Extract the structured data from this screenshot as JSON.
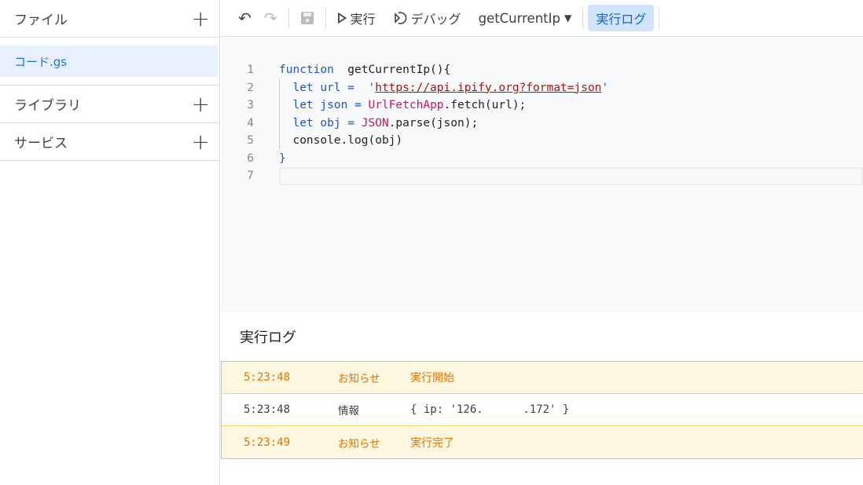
{
  "sidebar": {
    "files_label": "ファイル",
    "file_item": "コード.gs",
    "libraries_label": "ライブラリ",
    "services_label": "サービス"
  },
  "toolbar": {
    "undo_icon": "↶",
    "redo_icon": "↷",
    "run_label": "実行",
    "debug_label": "デバッグ",
    "function_select": "getCurrentIp",
    "log_label": "実行ログ"
  },
  "editor": {
    "lines": [
      {
        "n": "1"
      },
      {
        "n": "2"
      },
      {
        "n": "3"
      },
      {
        "n": "4"
      },
      {
        "n": "5"
      },
      {
        "n": "6"
      },
      {
        "n": "7"
      }
    ],
    "code": {
      "l1a": "function",
      "l1b": "  getCurrentIp(){",
      "l2a": "  let url =  '",
      "l2b": "https://api.ipify.org?format=json",
      "l2c": "'",
      "l3a": "  let json = ",
      "l3b": "UrlFetchApp",
      "l3c": ".fetch(url);",
      "l4a": "  let obj = ",
      "l4b": "JSON",
      "l4c": ".parse(json);",
      "l5": "  console.log(obj)",
      "l6": "}"
    }
  },
  "log": {
    "title": "実行ログ",
    "rows": [
      {
        "time": "5:23:48",
        "level": "お知らせ",
        "message": "実行開始",
        "type": "notice"
      },
      {
        "time": "5:23:48",
        "level": "情報",
        "message": "{ ip: '126.      .172' }",
        "type": "info"
      },
      {
        "time": "5:23:49",
        "level": "お知らせ",
        "message": "実行完了",
        "type": "notice"
      }
    ]
  },
  "colors": {
    "accent": "#1a73e8",
    "notice": "#e37400",
    "notice_bg": "#fef7e0"
  }
}
